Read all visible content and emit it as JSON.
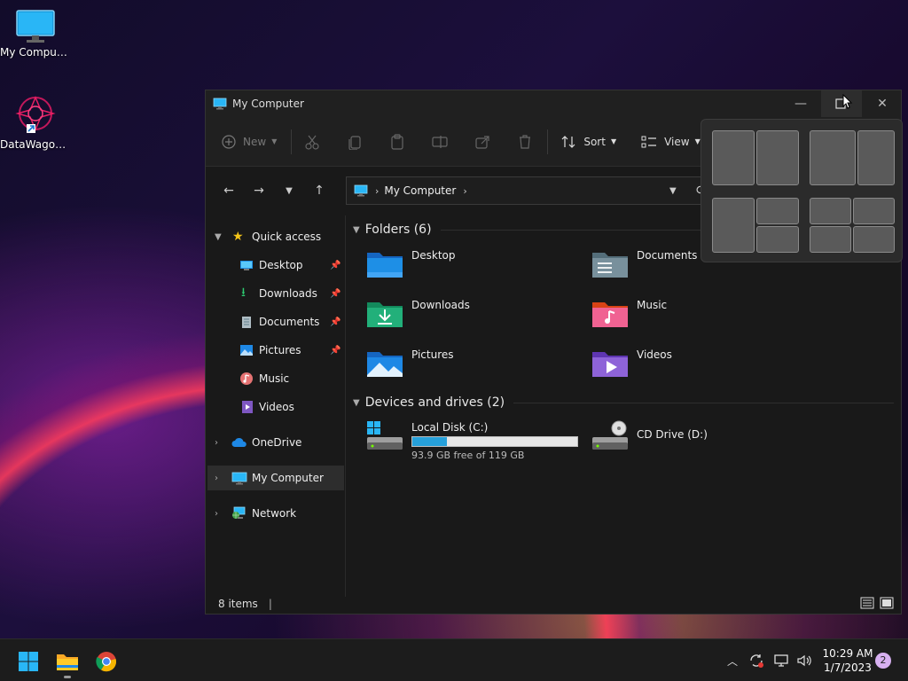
{
  "desktop": {
    "icons": [
      {
        "label": "My Computer",
        "icon": "monitor-icon"
      },
      {
        "label": "DataWagon...",
        "icon": "datawagon-shortcut-icon"
      }
    ]
  },
  "window": {
    "title": "My Computer",
    "controls": {
      "minimize": "—",
      "maximize": "☐",
      "close": "✕"
    }
  },
  "toolbar": {
    "new_label": "New",
    "sort_label": "Sort",
    "view_label": "View",
    "disabled_icons": [
      "cut-icon",
      "copy-icon",
      "paste-icon",
      "rename-icon",
      "share-icon",
      "delete-icon"
    ]
  },
  "address": {
    "path": [
      "My Computer"
    ]
  },
  "sidebar": {
    "quick_access": "Quick access",
    "items": [
      {
        "label": "Desktop",
        "pinned": true
      },
      {
        "label": "Downloads",
        "pinned": true
      },
      {
        "label": "Documents",
        "pinned": true
      },
      {
        "label": "Pictures",
        "pinned": true
      },
      {
        "label": "Music",
        "pinned": false
      },
      {
        "label": "Videos",
        "pinned": false
      }
    ],
    "onedrive": "OneDrive",
    "my_computer": "My Computer",
    "network": "Network"
  },
  "content": {
    "folders_header": "Folders (6)",
    "folders": [
      {
        "name": "Desktop"
      },
      {
        "name": "Documents"
      },
      {
        "name": "Downloads"
      },
      {
        "name": "Music"
      },
      {
        "name": "Pictures"
      },
      {
        "name": "Videos"
      }
    ],
    "drives_header": "Devices and drives (2)",
    "drives": [
      {
        "name": "Local Disk (C:)",
        "free_text": "93.9 GB free of 119 GB",
        "used_fraction": 0.21
      },
      {
        "name": "CD Drive (D:)"
      }
    ]
  },
  "status": {
    "items_count": "8 items"
  },
  "taskbar": {
    "time": "10:29 AM",
    "date": "1/7/2023",
    "notification_count": "2"
  },
  "colors": {
    "accent": "#26a0da",
    "folder_blue": "#1e8fe6",
    "folder_green": "#22b07a"
  }
}
